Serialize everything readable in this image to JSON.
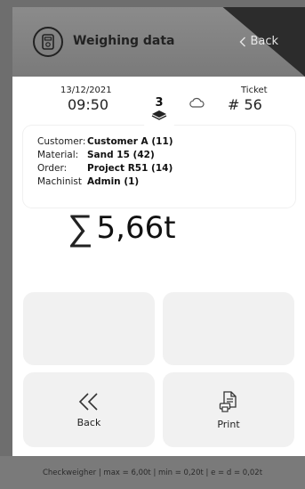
{
  "header": {
    "title": "Weighing data",
    "back_label": "Back"
  },
  "info": {
    "date": "13/12/2021",
    "time": "09:50",
    "count": "3",
    "ticket_label": "Ticket",
    "ticket_number": "# 56"
  },
  "details": {
    "rows": [
      {
        "label": "Customer:",
        "value": "Customer A (11)"
      },
      {
        "label": "Material:",
        "value": "Sand 15 (42)"
      },
      {
        "label": "Order:",
        "value": "Project R51 (14)"
      },
      {
        "label": "Machinist",
        "value": "Admin (1)"
      }
    ]
  },
  "total": {
    "symbol": "∑",
    "weight": "5,66t"
  },
  "actions": {
    "back_label": "Back",
    "print_label": "Print"
  },
  "footer": {
    "text": "Checkweigher | max = 6,00t | min = 0,20t | e = d = 0,02t"
  },
  "icons": {
    "header": "scale-icon",
    "cloud": "cloud-icon",
    "layers": "layers-icon",
    "back": "double-chevron-left-icon",
    "print": "printer-icon"
  }
}
